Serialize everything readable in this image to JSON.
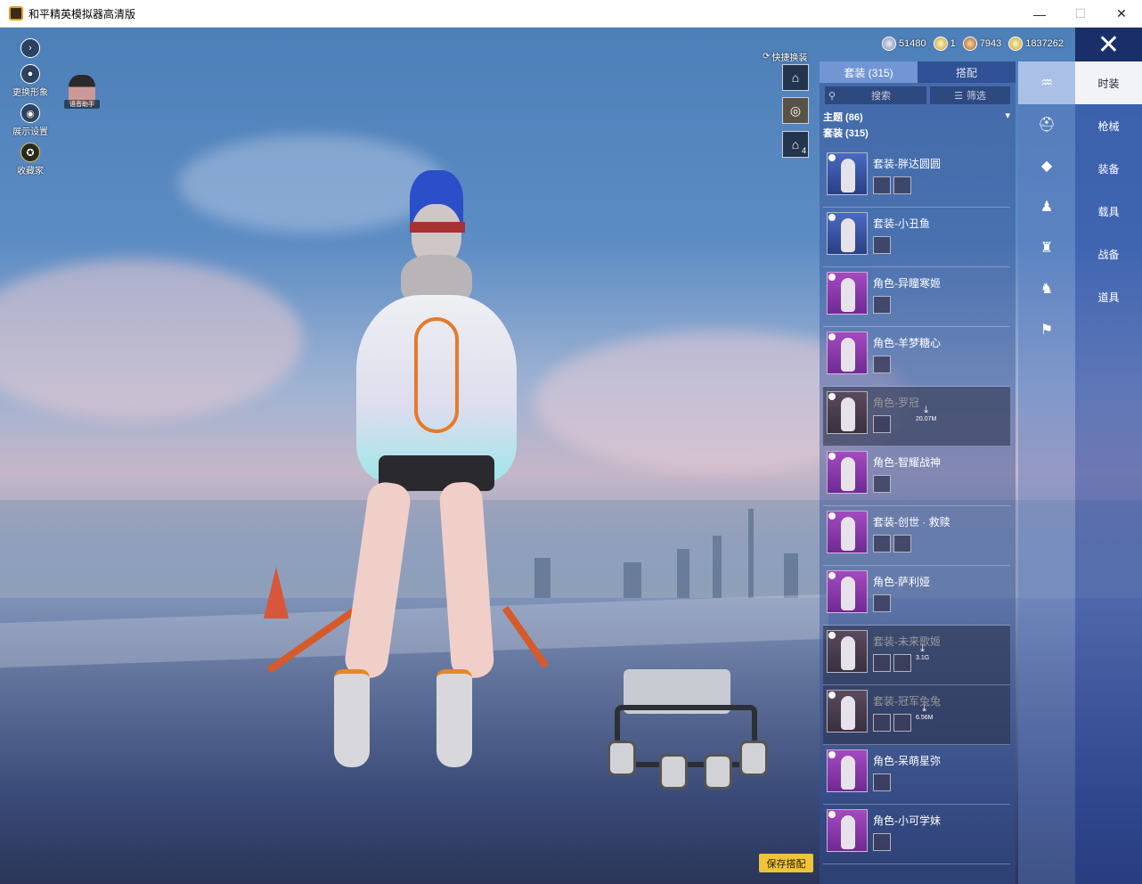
{
  "window": {
    "title": "和平精英模拟器高清版",
    "minimize": "—",
    "maximize": "☐",
    "close": "✕"
  },
  "left_menu": {
    "items": [
      {
        "icon": "chevron-right-icon",
        "label": ""
      },
      {
        "icon": "person-icon",
        "label": "更换形象"
      },
      {
        "icon": "eye-icon",
        "label": "展示设置"
      },
      {
        "icon": "medal-icon",
        "label": "收藏家"
      }
    ],
    "voice_assistant": "语音助手"
  },
  "currencies": [
    {
      "icon": "silver-coin-icon",
      "value": "51480"
    },
    {
      "icon": "badge-coin-icon",
      "value": "1"
    },
    {
      "icon": "bronze-coin-icon",
      "value": "7943"
    },
    {
      "icon": "gold-coin-icon",
      "value": "1837262"
    }
  ],
  "quick_change": {
    "label": "快捷换装",
    "badge": "4"
  },
  "panel": {
    "tabs": [
      {
        "label": "套装 (315)",
        "active": true
      },
      {
        "label": "搭配",
        "active": false
      }
    ],
    "search_label": "搜索",
    "filter_label": "筛选",
    "theme": "主题 (86)",
    "suit_count": "套装 (315)",
    "items": [
      {
        "name": "套装-胖达圆圆",
        "thumb": "blue",
        "subs": 2,
        "dim": false,
        "download": ""
      },
      {
        "name": "套装-小丑鱼",
        "thumb": "blue",
        "subs": 1,
        "dim": false,
        "download": ""
      },
      {
        "name": "角色-异瞳寒姬",
        "thumb": "purple",
        "subs": 1,
        "dim": false,
        "download": ""
      },
      {
        "name": "角色-羊梦糖心",
        "thumb": "purple",
        "subs": 1,
        "dim": false,
        "download": ""
      },
      {
        "name": "角色-罗冠",
        "thumb": "dim",
        "subs": 1,
        "dim": true,
        "download": "20.07M"
      },
      {
        "name": "角色-智耀战神",
        "thumb": "purple",
        "subs": 1,
        "dim": false,
        "download": ""
      },
      {
        "name": "套装-创世 · 救赎",
        "thumb": "purple",
        "subs": 2,
        "dim": false,
        "download": ""
      },
      {
        "name": "角色-萨利娅",
        "thumb": "purple",
        "subs": 1,
        "dim": false,
        "download": ""
      },
      {
        "name": "套装-未来歌姬",
        "thumb": "dim",
        "subs": 2,
        "dim": true,
        "download": "3.1G"
      },
      {
        "name": "套装-冠军兔兔",
        "thumb": "dim",
        "subs": 2,
        "dim": true,
        "download": "6.56M"
      },
      {
        "name": "角色-呆萌星弥",
        "thumb": "purple",
        "subs": 1,
        "dim": false,
        "download": ""
      },
      {
        "name": "角色-小可学妹",
        "thumb": "purple",
        "subs": 1,
        "dim": false,
        "download": ""
      }
    ]
  },
  "side_icons": [
    "outfit-icon",
    "hat-icon",
    "mask-icon",
    "top-icon",
    "pants-icon",
    "full-body-icon",
    "shoes-icon"
  ],
  "categories": [
    {
      "label": "时装",
      "active": true
    },
    {
      "label": "枪械",
      "active": false
    },
    {
      "label": "装备",
      "active": false
    },
    {
      "label": "载具",
      "active": false
    },
    {
      "label": "战备",
      "active": false
    },
    {
      "label": "道具",
      "active": false
    }
  ],
  "save_button": "保存搭配",
  "close_x": "✕"
}
